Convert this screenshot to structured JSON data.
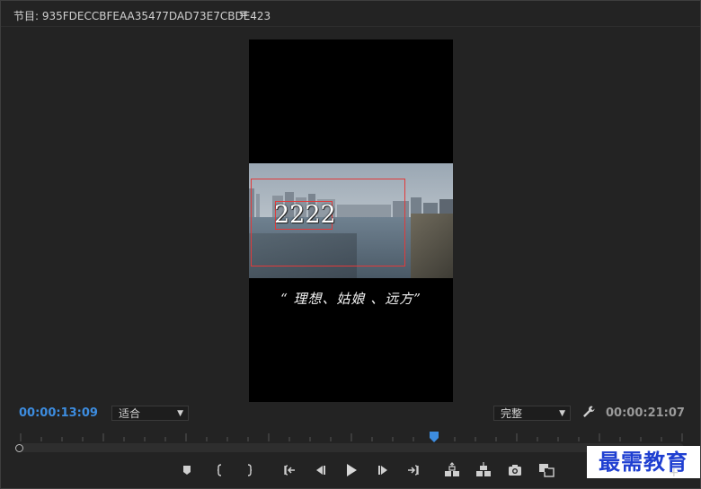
{
  "panel": {
    "title": "节目: 935FDECCBFEAA35477DAD73E7CBDE423",
    "menu_glyph": "≡"
  },
  "viewer": {
    "title_text": "2222",
    "subtitle": "“ 理想、姑娘 、远方”"
  },
  "controls": {
    "current_timecode": "00:00:13:09",
    "zoom_value": "适合",
    "quality_value": "完整",
    "duration_timecode": "00:00:21:07"
  },
  "playback": {
    "playhead_fraction": 0.624
  },
  "watermark": {
    "text": "最需教育"
  },
  "colors": {
    "timecode_accent": "#3d8de0",
    "selection_box": "#e23a3a",
    "playhead": "#3d8de0",
    "watermark_text": "#1f3fd1"
  },
  "icons": {
    "panel_menu": "hamburger-icon",
    "settings": "wrench-icon",
    "transport": [
      "add-marker-icon",
      "mark-in-icon",
      "mark-out-icon",
      "go-to-in-icon",
      "step-back-icon",
      "play-icon",
      "step-forward-icon",
      "go-to-out-icon",
      "lift-icon",
      "extract-icon",
      "export-frame-icon",
      "comparison-view-icon"
    ]
  },
  "add_button_glyph": "+"
}
